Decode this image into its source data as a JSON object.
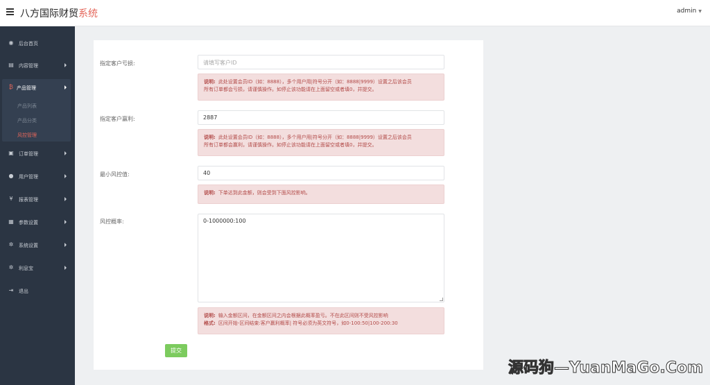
{
  "header": {
    "title_main": "八方国际财贸",
    "title_accent": "系统",
    "user": "admin",
    "menu_icon": "hamburger-icon",
    "dropdown_icon": "caret-down-icon"
  },
  "sidebar": {
    "items": [
      {
        "label": "后台首页",
        "icon": "◉",
        "icon_name": "dashboard-icon"
      },
      {
        "label": "内容管理",
        "icon": "▤",
        "icon_name": "book-icon"
      },
      {
        "label": "产品管理",
        "icon": "₿",
        "icon_name": "bitcoin-icon"
      },
      {
        "label": "订单管理",
        "icon": "▣",
        "icon_name": "copy-icon"
      },
      {
        "label": "用户管理",
        "icon": "●",
        "icon_name": "user-icon"
      },
      {
        "label": "报表管理",
        "icon": "¥",
        "icon_name": "yen-icon"
      },
      {
        "label": "参数设置",
        "icon": "▦",
        "icon_name": "documents-icon"
      },
      {
        "label": "系统设置",
        "icon": "✲",
        "icon_name": "cogs-icon"
      },
      {
        "label": "利息宝",
        "icon": "✲",
        "icon_name": "cogs-icon"
      },
      {
        "label": "退出",
        "icon": "⇥",
        "icon_name": "sign-out-icon"
      }
    ],
    "sub_items": [
      {
        "label": "产品列表"
      },
      {
        "label": "产品分类"
      },
      {
        "label": "风控管理"
      }
    ]
  },
  "form": {
    "loss_label": "指定客户亏损:",
    "loss_placeholder": "请填写客户ID",
    "loss_value": "",
    "loss_note_prefix": "说明:",
    "loss_note_line1": "此处设置会员ID（如：8888），多个用户用|符号分开（如：8888|9999）设置之后该会员",
    "loss_note_line2": "所有订单都会亏损，请谨慎操作。如停止该功能请在上面留空或者填0，并提交。",
    "profit_label": "指定客户赢利:",
    "profit_value": "2887",
    "profit_note_prefix": "说明:",
    "profit_note_line1": "此处设置会员ID（如：8888），多个用户用|符号分开（如：8888|9999）设置之后该会员",
    "profit_note_line2": "所有订单都会赢利，请谨慎操作。如停止该功能请在上面留空或者填0，并提交。",
    "min_label": "最小风控值:",
    "min_value": "40",
    "min_note_prefix": "说明:",
    "min_note": "下单达到此金额，则会受到下面风控影响。",
    "prob_label": "风控概率:",
    "prob_value": "0-1000000:100",
    "prob_note_prefix": "说明:",
    "prob_note_line1": "输入金额区间，在金额区间之内会根据此概率盈亏。不在此区间则不受风控影响",
    "prob_note_prefix2": "格式:",
    "prob_note_line2": "区间开始-区间结束:客户赢利概率|        符号必须为英文符号，如0-100:50|100-200:30",
    "submit_label": "提交"
  },
  "watermark": "源码狗—YuanMaGo.Com"
}
